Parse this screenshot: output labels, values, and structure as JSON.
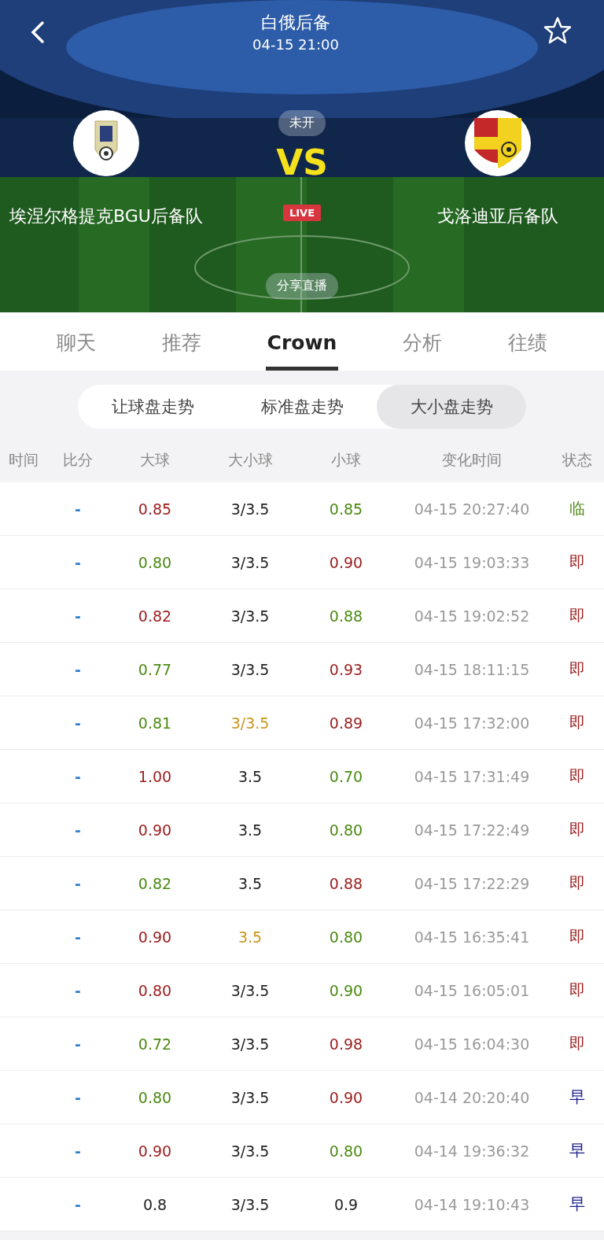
{
  "header": {
    "title": "白俄后备",
    "datetime": "04-15 21:00",
    "status": "未开",
    "vs": "VS",
    "live": "LIVE",
    "share": "分享直播",
    "favorited": false
  },
  "home": {
    "name": "埃涅尔格提克BGU后备队"
  },
  "away": {
    "name": "戈洛迪亚后备队"
  },
  "tabs": [
    {
      "label": "聊天",
      "selected": false
    },
    {
      "label": "推荐",
      "selected": false
    },
    {
      "label": "Crown",
      "selected": true
    },
    {
      "label": "分析",
      "selected": false
    },
    {
      "label": "往绩",
      "selected": false
    }
  ],
  "segments": [
    {
      "label": "让球盘走势",
      "selected": false
    },
    {
      "label": "标准盘走势",
      "selected": false
    },
    {
      "label": "大小盘走势",
      "selected": true
    }
  ],
  "table": {
    "columns": [
      "时间",
      "比分",
      "大球",
      "大小球",
      "小球",
      "变化时间",
      "状态"
    ],
    "rows": [
      {
        "score": "-",
        "over": {
          "text": "0.85",
          "color": "#9b1c1c"
        },
        "line": {
          "text": "3/3.5",
          "color": "#222222"
        },
        "under": {
          "text": "0.85",
          "color": "#4b8a12"
        },
        "changed": "04-15 20:27:40",
        "state": {
          "text": "临",
          "color": "#4b8a12"
        }
      },
      {
        "score": "-",
        "over": {
          "text": "0.80",
          "color": "#4b8a12"
        },
        "line": {
          "text": "3/3.5",
          "color": "#222222"
        },
        "under": {
          "text": "0.90",
          "color": "#9b1c1c"
        },
        "changed": "04-15 19:03:33",
        "state": {
          "text": "即",
          "color": "#9b1c1c"
        }
      },
      {
        "score": "-",
        "over": {
          "text": "0.82",
          "color": "#9b1c1c"
        },
        "line": {
          "text": "3/3.5",
          "color": "#222222"
        },
        "under": {
          "text": "0.88",
          "color": "#4b8a12"
        },
        "changed": "04-15 19:02:52",
        "state": {
          "text": "即",
          "color": "#9b1c1c"
        }
      },
      {
        "score": "-",
        "over": {
          "text": "0.77",
          "color": "#4b8a12"
        },
        "line": {
          "text": "3/3.5",
          "color": "#222222"
        },
        "under": {
          "text": "0.93",
          "color": "#9b1c1c"
        },
        "changed": "04-15 18:11:15",
        "state": {
          "text": "即",
          "color": "#9b1c1c"
        }
      },
      {
        "score": "-",
        "over": {
          "text": "0.81",
          "color": "#4b8a12"
        },
        "line": {
          "text": "3/3.5",
          "color": "#c8961e"
        },
        "under": {
          "text": "0.89",
          "color": "#9b1c1c"
        },
        "changed": "04-15 17:32:00",
        "state": {
          "text": "即",
          "color": "#9b1c1c"
        }
      },
      {
        "score": "-",
        "over": {
          "text": "1.00",
          "color": "#9b1c1c"
        },
        "line": {
          "text": "3.5",
          "color": "#222222"
        },
        "under": {
          "text": "0.70",
          "color": "#4b8a12"
        },
        "changed": "04-15 17:31:49",
        "state": {
          "text": "即",
          "color": "#9b1c1c"
        }
      },
      {
        "score": "-",
        "over": {
          "text": "0.90",
          "color": "#9b1c1c"
        },
        "line": {
          "text": "3.5",
          "color": "#222222"
        },
        "under": {
          "text": "0.80",
          "color": "#4b8a12"
        },
        "changed": "04-15 17:22:49",
        "state": {
          "text": "即",
          "color": "#9b1c1c"
        }
      },
      {
        "score": "-",
        "over": {
          "text": "0.82",
          "color": "#4b8a12"
        },
        "line": {
          "text": "3.5",
          "color": "#222222"
        },
        "under": {
          "text": "0.88",
          "color": "#9b1c1c"
        },
        "changed": "04-15 17:22:29",
        "state": {
          "text": "即",
          "color": "#9b1c1c"
        }
      },
      {
        "score": "-",
        "over": {
          "text": "0.90",
          "color": "#9b1c1c"
        },
        "line": {
          "text": "3.5",
          "color": "#c8961e"
        },
        "under": {
          "text": "0.80",
          "color": "#4b8a12"
        },
        "changed": "04-15 16:35:41",
        "state": {
          "text": "即",
          "color": "#9b1c1c"
        }
      },
      {
        "score": "-",
        "over": {
          "text": "0.80",
          "color": "#9b1c1c"
        },
        "line": {
          "text": "3/3.5",
          "color": "#222222"
        },
        "under": {
          "text": "0.90",
          "color": "#4b8a12"
        },
        "changed": "04-15 16:05:01",
        "state": {
          "text": "即",
          "color": "#9b1c1c"
        }
      },
      {
        "score": "-",
        "over": {
          "text": "0.72",
          "color": "#4b8a12"
        },
        "line": {
          "text": "3/3.5",
          "color": "#222222"
        },
        "under": {
          "text": "0.98",
          "color": "#9b1c1c"
        },
        "changed": "04-15 16:04:30",
        "state": {
          "text": "即",
          "color": "#9b1c1c"
        }
      },
      {
        "score": "-",
        "over": {
          "text": "0.80",
          "color": "#4b8a12"
        },
        "line": {
          "text": "3/3.5",
          "color": "#222222"
        },
        "under": {
          "text": "0.90",
          "color": "#9b1c1c"
        },
        "changed": "04-14 20:20:40",
        "state": {
          "text": "早",
          "color": "#1a1f8c"
        }
      },
      {
        "score": "-",
        "over": {
          "text": "0.90",
          "color": "#9b1c1c"
        },
        "line": {
          "text": "3/3.5",
          "color": "#222222"
        },
        "under": {
          "text": "0.80",
          "color": "#4b8a12"
        },
        "changed": "04-14 19:36:32",
        "state": {
          "text": "早",
          "color": "#1a1f8c"
        }
      },
      {
        "score": "-",
        "over": {
          "text": "0.8",
          "color": "#222222"
        },
        "line": {
          "text": "3/3.5",
          "color": "#222222"
        },
        "under": {
          "text": "0.9",
          "color": "#222222"
        },
        "changed": "04-14 19:10:43",
        "state": {
          "text": "早",
          "color": "#1a1f8c"
        }
      }
    ]
  }
}
